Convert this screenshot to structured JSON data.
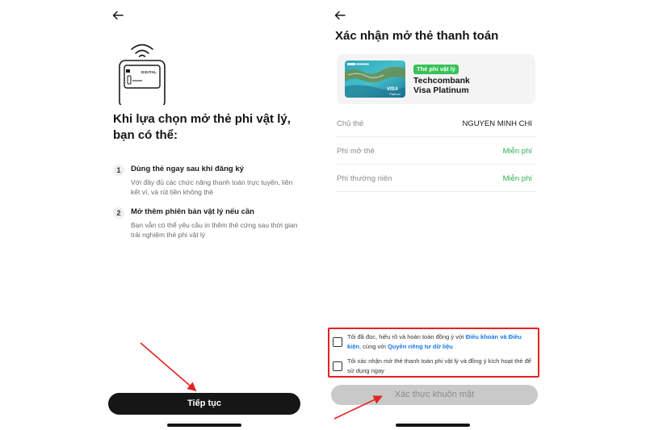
{
  "left_screen": {
    "title": "Khi lựa chọn mở thẻ phi vật lý, bạn có thể:",
    "phone_label": "DIGITAL",
    "steps": [
      {
        "number": "1",
        "title": "Dùng thẻ ngay sau khi đăng ký",
        "description": "Với đầy đủ các chức năng thanh toán trực tuyến, liên kết ví, và rút tiền không thẻ"
      },
      {
        "number": "2",
        "title": "Mở thêm phiên bản vật lý nếu cần",
        "description": "Bạn vẫn có thể yêu cầu in thêm thẻ cứng sau thời gian trải nghiệm thẻ phi vật lý"
      }
    ],
    "continue_label": "Tiếp tục"
  },
  "right_screen": {
    "title": "Xác nhận mở thẻ thanh toán",
    "card": {
      "badge": "Thẻ phi vật lý",
      "name_line1": "Techcombank",
      "name_line2": "Visa Platinum",
      "brand": "VISA",
      "brand_sub": "Platinum"
    },
    "info_rows": [
      {
        "label": "Chủ thẻ",
        "value": "NGUYEN MINH CHI"
      },
      {
        "label": "Phí mở thẻ",
        "value": "Miễn phí"
      },
      {
        "label": "Phí thường niên",
        "value": "Miễn phí"
      }
    ],
    "consent": {
      "item1_prefix": "Tôi đã đọc, hiểu rõ và hoàn toàn đồng ý với ",
      "item1_link1": "Điều khoản và Điều kiện",
      "item1_middle": ", cùng với ",
      "item1_link2": "Quyền riêng tư dữ liệu",
      "item2_text": "Tôi xác nhận mở thẻ thanh toán phi vật lý và đồng ý kích hoạt thẻ để sử dụng ngay"
    },
    "verify_label": "Xác thực khuôn mặt"
  },
  "colors": {
    "primary_button": "#161616",
    "badge_green": "#37c259",
    "value_green": "#2eb152",
    "link_blue": "#1778e6",
    "annotation_red": "#e52222",
    "disabled_button": "#c9c9c9"
  },
  "icons": {
    "back": "arrow-left-icon",
    "illustration": "contactless-phone-icon"
  }
}
